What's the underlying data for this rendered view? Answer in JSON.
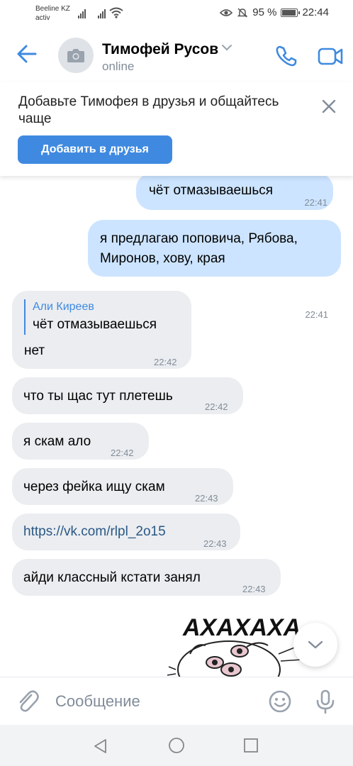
{
  "status_bar": {
    "carrier_name": "Beeline KZ",
    "carrier_sub": "activ",
    "battery_percent": "95 %",
    "battery_level": 0.95,
    "time": "22:44"
  },
  "header": {
    "contact_name": "Тимофей Русов",
    "contact_status": "online"
  },
  "banner": {
    "text": "Добавьте Тимофея в друзья и общайтесь чаще",
    "button_label": "Добавить в друзья"
  },
  "messages": [
    {
      "direction": "out",
      "text": "чёт отмазываешься",
      "time": "22:41"
    },
    {
      "direction": "out",
      "text_line1": "я предлагаю поповича, Рябова,",
      "text_line2": "Миронов, хову, края",
      "time": "22:41"
    },
    {
      "direction": "in",
      "reply_author": "Али Киреев",
      "reply_text": "чёт отмазываешься",
      "text": "нет",
      "time": "22:42"
    },
    {
      "direction": "in",
      "text": "что ты щас тут плетешь",
      "time": "22:42"
    },
    {
      "direction": "in",
      "text": "я скам ало",
      "time": "22:42"
    },
    {
      "direction": "in",
      "text": "через фейка ищу скам",
      "time": "22:43"
    },
    {
      "direction": "in",
      "text": "https://vk.com/rlpl_2o15",
      "time": "22:43",
      "is_link": true
    },
    {
      "direction": "in",
      "text": "айди классный кстати занял",
      "time": "22:43"
    }
  ],
  "sticker": {
    "text": "АХАХАХА"
  },
  "composer": {
    "placeholder": "Сообщение"
  },
  "colors": {
    "accent": "#3f8ae0",
    "outgoing_bubble": "#cce4ff",
    "incoming_bubble": "#ebedf0",
    "secondary_text": "#818c99"
  },
  "icons": [
    "back-arrow-icon",
    "camera-icon",
    "chevron-down-icon",
    "phone-icon",
    "video-camera-icon",
    "close-icon",
    "attach-icon",
    "emoji-icon",
    "microphone-icon",
    "nav-back-icon",
    "nav-home-icon",
    "nav-recent-icon"
  ]
}
